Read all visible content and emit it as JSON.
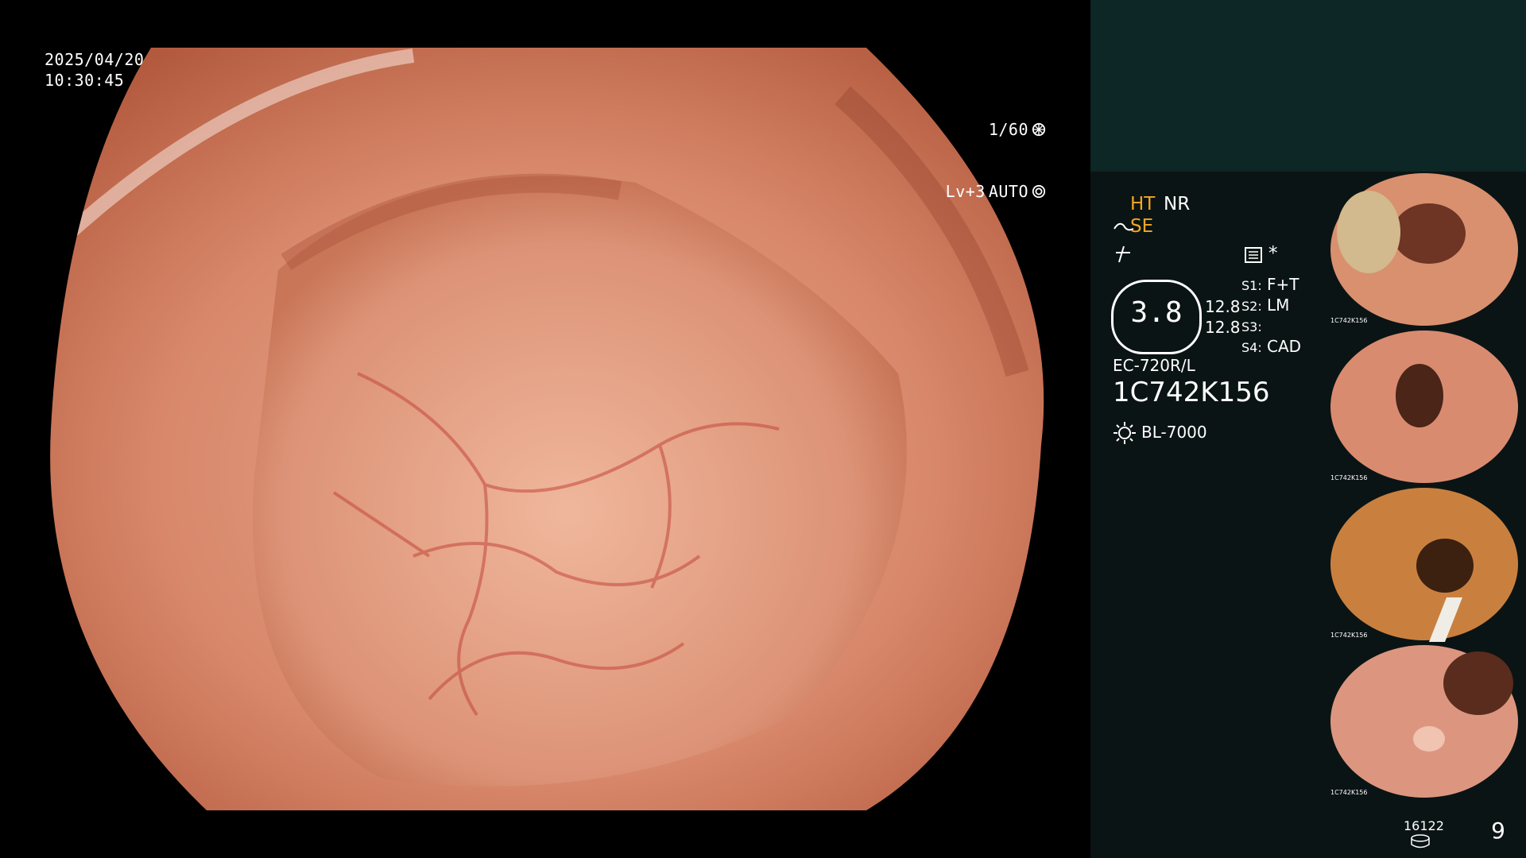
{
  "overlay": {
    "date": "2025/04/20",
    "time": "10:30:45",
    "shutter": "1/60",
    "level": "Lv+3",
    "mode": "AUTO"
  },
  "settings": {
    "ht": "HT",
    "nr": "NR",
    "se": "SE",
    "gauge_value": "3.8",
    "value_a": "12.8",
    "value_b": "12.8",
    "s1_label": "S1:",
    "s1_value": "F+T",
    "s2_label": "S2:",
    "s2_value": "LM",
    "s3_label": "S3:",
    "s3_value": "",
    "s4_label": "S4:",
    "s4_value": "CAD",
    "asterisk": "*"
  },
  "device": {
    "scope_model": "EC-720R/L",
    "serial": "1C742K156",
    "light_source": "BL-7000"
  },
  "thumbnails": [
    {
      "label": "1C742K156"
    },
    {
      "label": "1C742K156"
    },
    {
      "label": "1C742K156"
    },
    {
      "label": "1C742K156"
    }
  ],
  "footer": {
    "storage_count": "16122",
    "image_count": "9"
  },
  "colors": {
    "accent": "#f5a623",
    "panel_bg": "#0b1414",
    "header_bg": "#0d2626"
  },
  "icons": [
    "gauge-icon",
    "shutter-icon",
    "auto-iris-icon",
    "scope-icon",
    "light-icon",
    "disk-icon",
    "menu-icon"
  ]
}
